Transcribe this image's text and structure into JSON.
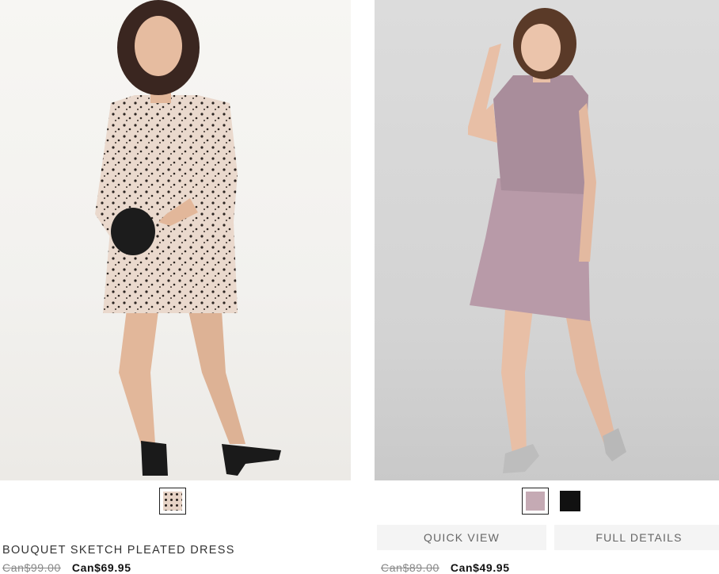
{
  "products": [
    {
      "name": "BOUQUET SKETCH PLEATED DRESS",
      "original_price": "Can$99.00",
      "sale_price": "Can$69.95",
      "swatches": [
        {
          "color": "#e6d3c6",
          "pattern": "black dots",
          "selected": true
        }
      ]
    },
    {
      "name": "",
      "original_price": "Can$89.00",
      "sale_price": "Can$49.95",
      "swatches": [
        {
          "color": "#c5aab4",
          "selected": true
        },
        {
          "color": "#111111",
          "selected": false
        }
      ],
      "actions": {
        "quick_view": "QUICK VIEW",
        "full_details": "FULL DETAILS"
      }
    }
  ]
}
